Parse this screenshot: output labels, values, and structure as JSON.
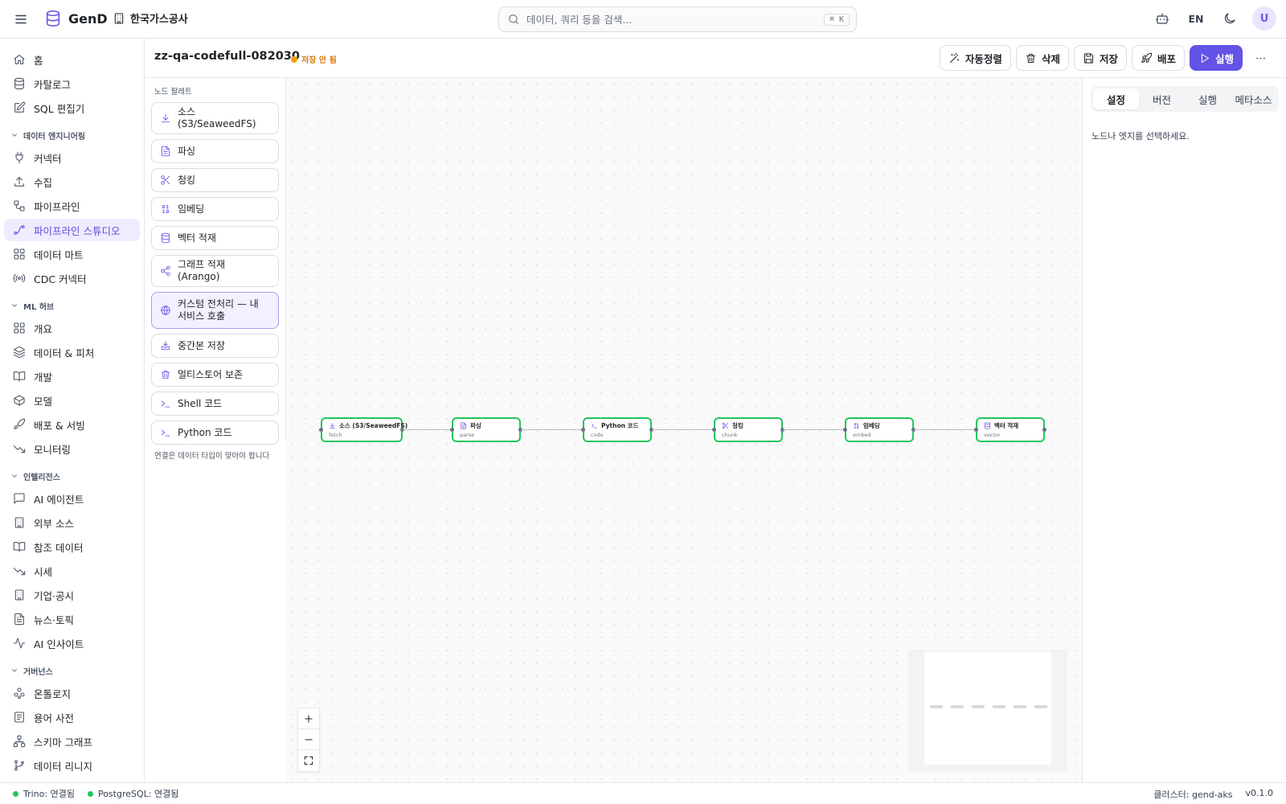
{
  "app": {
    "name": "GenD",
    "org": "한국가스공사"
  },
  "search": {
    "placeholder": "데이터, 쿼리 등을 검색...",
    "shortcut": "⌘ K"
  },
  "topbar": {
    "lang": "EN",
    "avatar": "U"
  },
  "sidebar": {
    "top": [
      {
        "label": "홈",
        "icon": "home-icon"
      },
      {
        "label": "카탈로그",
        "icon": "database-icon"
      },
      {
        "label": "SQL 편집기",
        "icon": "edit-icon"
      }
    ],
    "sections": [
      {
        "title": "데이터 엔지니어링",
        "items": [
          {
            "label": "커넥터",
            "icon": "plug-icon"
          },
          {
            "label": "수집",
            "icon": "upload-icon"
          },
          {
            "label": "파이프라인",
            "icon": "workflow-icon"
          },
          {
            "label": "파이프라인 스튜디오",
            "icon": "spline-icon",
            "active": true
          },
          {
            "label": "데이터 마트",
            "icon": "grid-icon"
          },
          {
            "label": "CDC 커넥터",
            "icon": "radio-icon"
          }
        ]
      },
      {
        "title": "ML 허브",
        "items": [
          {
            "label": "개요",
            "icon": "grid-icon"
          },
          {
            "label": "데이터 & 피처",
            "icon": "layers-icon"
          },
          {
            "label": "개발",
            "icon": "book-icon"
          },
          {
            "label": "모델",
            "icon": "box-icon"
          },
          {
            "label": "배포 & 서빙",
            "icon": "rocket-icon"
          },
          {
            "label": "모니터링",
            "icon": "trend-icon"
          }
        ]
      },
      {
        "title": "인텔리전스",
        "items": [
          {
            "label": "AI 에이전트",
            "icon": "chat-icon"
          },
          {
            "label": "외부 소스",
            "icon": "building-icon"
          },
          {
            "label": "참조 데이터",
            "icon": "book-icon"
          },
          {
            "label": "시세",
            "icon": "trend-icon"
          },
          {
            "label": "기업·공시",
            "icon": "building-icon"
          },
          {
            "label": "뉴스·토픽",
            "icon": "file-icon"
          },
          {
            "label": "AI 인사이트",
            "icon": "activity-icon"
          }
        ]
      },
      {
        "title": "거버넌스",
        "items": [
          {
            "label": "온톨로지",
            "icon": "cluster-icon"
          },
          {
            "label": "용어 사전",
            "icon": "list-icon"
          },
          {
            "label": "스키마 그래프",
            "icon": "network-icon"
          },
          {
            "label": "데이터 리니지",
            "icon": "branch-icon"
          }
        ]
      }
    ]
  },
  "pipeline": {
    "title": "zz-qa-codefull-082030",
    "status": "저장 안 됨"
  },
  "actions": {
    "autolayout": "자동정렬",
    "delete": "삭제",
    "save": "저장",
    "deploy": "배포",
    "run": "실행"
  },
  "palette": {
    "title": "노드 팔레트",
    "items": [
      {
        "label": "소스 (S3/SeaweedFS)",
        "icon": "download-icon"
      },
      {
        "label": "파싱",
        "icon": "file-icon"
      },
      {
        "label": "청킹",
        "icon": "scissors-icon"
      },
      {
        "label": "임베딩",
        "icon": "binary-icon"
      },
      {
        "label": "벡터 적재",
        "icon": "database-icon"
      },
      {
        "label": "그래프 적재 (Arango)",
        "icon": "share-icon"
      },
      {
        "label": "커스텀 전처리 — 내 서비스 호출",
        "icon": "globe-icon",
        "tall": true
      },
      {
        "label": "중간본 저장",
        "icon": "tray-icon"
      },
      {
        "label": "멀티스토어 보존",
        "icon": "trash-icon"
      },
      {
        "label": "Shell 코드",
        "icon": "terminal-icon"
      },
      {
        "label": "Python 코드",
        "icon": "terminal-icon"
      }
    ],
    "hint": "연결은 데이터 타입이 맞아야 합니다"
  },
  "nodes": [
    {
      "label": "소스 (S3/SeaweedFS)",
      "sub": "fetch",
      "icon": "download-icon"
    },
    {
      "label": "파싱",
      "sub": "parse",
      "icon": "file-icon"
    },
    {
      "label": "Python 코드",
      "sub": "code",
      "icon": "terminal-icon"
    },
    {
      "label": "청킹",
      "sub": "chunk",
      "icon": "scissors-icon"
    },
    {
      "label": "임베딩",
      "sub": "embed",
      "icon": "binary-icon"
    },
    {
      "label": "벡터 적재",
      "sub": "vector",
      "icon": "database-icon"
    }
  ],
  "right_panel": {
    "tabs": [
      "설정",
      "버전",
      "실행",
      "메타소스"
    ],
    "active_tab": "설정",
    "hint": "노드나 엣지를 선택하세요."
  },
  "statusbar": {
    "trino": "Trino: 연결됨",
    "postgres": "PostgreSQL: 연결됨",
    "cluster": "클러스터: gend-aks",
    "version": "v0.1.0"
  },
  "colors": {
    "accent": "#6353e6",
    "node_border": "#22c55e",
    "status_ok": "#22c55e",
    "unsaved": "#f59e0b"
  }
}
